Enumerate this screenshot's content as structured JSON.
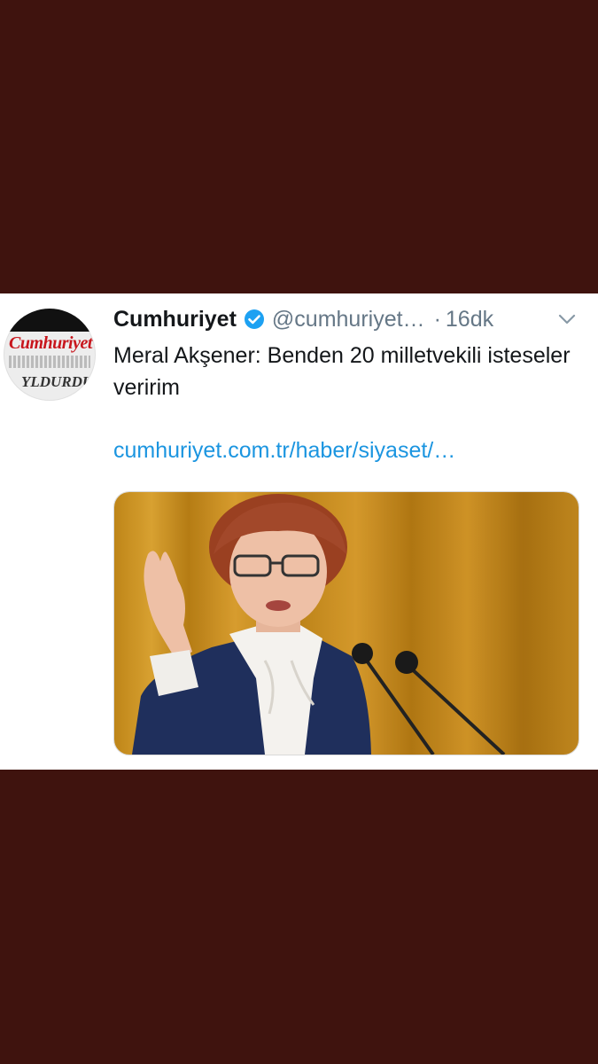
{
  "tweet": {
    "account_name": "Cumhuriyet",
    "handle": "@cumhuriyet…",
    "separator": "·",
    "time": "16dk",
    "text": "Meral Akşener: Benden 20 milletvekili isteseler veririm",
    "link": "cumhuriyet.com.tr/haber/siyaset/…",
    "verified": true
  },
  "avatar": {
    "logo_text": "Cumhuriyet",
    "headline_text": "YLDURDUR"
  },
  "icons": {
    "verified": "verified-badge-icon",
    "menu": "chevron-down-icon"
  },
  "colors": {
    "background": "#3f130e",
    "card": "#ffffff",
    "link": "#1b95e0",
    "verified": "#1da1f2",
    "secondary_text": "#657786"
  }
}
